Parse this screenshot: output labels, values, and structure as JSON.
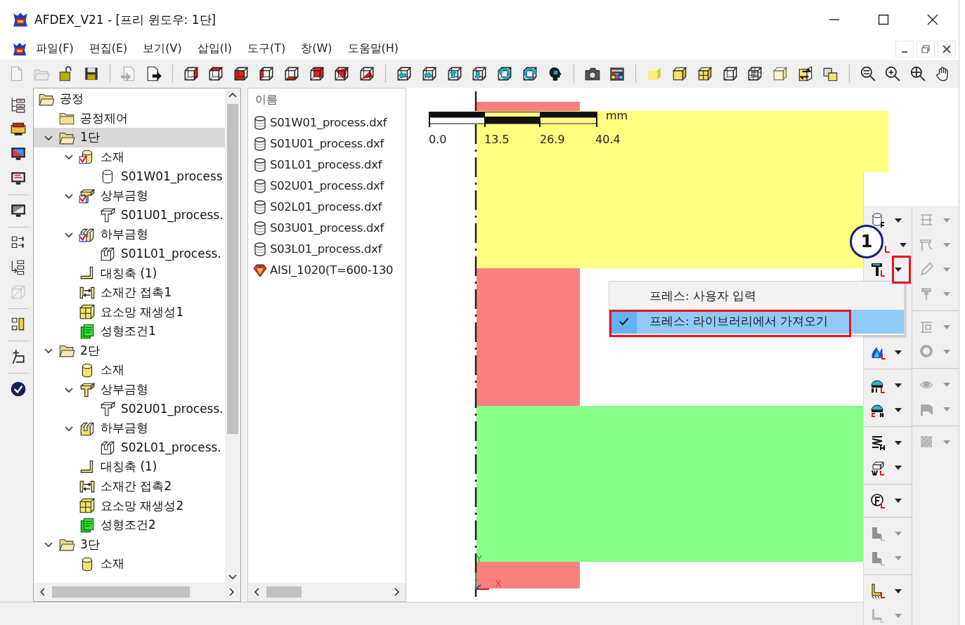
{
  "window": {
    "title": "AFDEX_V21 - [프리 윈도우: 1단]"
  },
  "menu": [
    "파일(F)",
    "편집(E)",
    "보기(V)",
    "삽입(I)",
    "도구(T)",
    "창(W)",
    "도움말(H)"
  ],
  "toolbar": {
    "groups": [
      [
        {
          "disabled": true
        },
        {
          "disabled": true
        },
        {
          "disabled": false
        },
        {
          "disabled": false
        }
      ],
      [
        {
          "disabled": true
        },
        {
          "disabled": false
        }
      ],
      [
        {
          "disabled": false
        },
        {
          "disabled": false
        },
        {
          "disabled": false
        },
        {
          "disabled": false
        },
        {
          "disabled": false
        },
        {
          "disabled": false
        },
        {
          "disabled": false
        },
        {
          "disabled": false
        }
      ],
      [
        {
          "disabled": false
        },
        {
          "disabled": false
        },
        {
          "disabled": false
        },
        {
          "disabled": false
        },
        {
          "disabled": false
        },
        {
          "disabled": false
        },
        {
          "disabled": false
        }
      ],
      [
        {
          "disabled": false
        },
        {
          "disabled": false
        }
      ],
      [
        {
          "disabled": false
        },
        {
          "disabled": false
        },
        {
          "disabled": false
        },
        {
          "disabled": false
        },
        {
          "disabled": false
        },
        {
          "disabled": false
        },
        {
          "disabled": false
        },
        {
          "disabled": false
        }
      ],
      [
        {
          "disabled": false
        },
        {
          "disabled": false
        },
        {
          "disabled": false
        },
        {
          "disabled": false
        }
      ]
    ]
  },
  "tool_strip": {
    "groups": [
      [
        {
          "disabled": false
        },
        {
          "disabled": false
        },
        {
          "disabled": false
        },
        {
          "disabled": false
        }
      ],
      [
        {
          "disabled": false
        }
      ],
      [
        {
          "disabled": false
        },
        {
          "disabled": false
        },
        {
          "disabled": true
        }
      ],
      [
        {
          "disabled": false
        }
      ],
      [
        {
          "disabled": false
        }
      ],
      [
        {
          "disabled": false
        }
      ]
    ]
  },
  "tree": {
    "items": [
      {
        "label": "공정",
        "kind": "folder-open",
        "selected": false,
        "children": [
          {
            "label": "공정제어",
            "kind": "folder",
            "selected": false
          },
          {
            "label": "1단",
            "kind": "folder-open",
            "selected": true,
            "expanded": true,
            "children": [
              {
                "label": "소재",
                "kind": "material",
                "selected": false,
                "expanded": true,
                "checked": true,
                "children": [
                  {
                    "label": "S01W01_process",
                    "kind": "file-material",
                    "selected": false
                  }
                ]
              },
              {
                "label": "상부금형",
                "kind": "upper-die",
                "selected": false,
                "expanded": true,
                "checked": true,
                "children": [
                  {
                    "label": "S01U01_process.",
                    "kind": "file-upper",
                    "selected": false
                  }
                ]
              },
              {
                "label": "하부금형",
                "kind": "lower-die",
                "selected": false,
                "expanded": true,
                "checked": true,
                "children": [
                  {
                    "label": "S01L01_process.",
                    "kind": "file-lower",
                    "selected": false
                  }
                ]
              },
              {
                "label": "대칭축 (1)",
                "kind": "symmetry",
                "selected": false
              },
              {
                "label": "소재간 접촉1",
                "kind": "contact",
                "selected": false
              },
              {
                "label": "요소망 재생성1",
                "kind": "remesh",
                "selected": false
              },
              {
                "label": "성형조건1",
                "kind": "condition",
                "selected": false
              }
            ]
          },
          {
            "label": "2단",
            "kind": "folder-open",
            "selected": false,
            "expanded": true,
            "children": [
              {
                "label": "소재",
                "kind": "material",
                "selected": false,
                "checked": false
              },
              {
                "label": "상부금형",
                "kind": "upper-die",
                "selected": false,
                "expanded": true,
                "checked": false,
                "children": [
                  {
                    "label": "S02U01_process.",
                    "kind": "file-upper",
                    "selected": false
                  }
                ]
              },
              {
                "label": "하부금형",
                "kind": "lower-die",
                "selected": false,
                "expanded": true,
                "checked": false,
                "children": [
                  {
                    "label": "S02L01_process.",
                    "kind": "file-lower",
                    "selected": false
                  }
                ]
              },
              {
                "label": "대칭축 (1)",
                "kind": "symmetry",
                "selected": false
              },
              {
                "label": "소재간 접촉2",
                "kind": "contact",
                "selected": false
              },
              {
                "label": "요소망 재생성2",
                "kind": "remesh",
                "selected": false
              },
              {
                "label": "성형조건2",
                "kind": "condition",
                "selected": false
              }
            ]
          },
          {
            "label": "3단",
            "kind": "folder-open",
            "selected": false,
            "expanded": true,
            "children": [
              {
                "label": "소재",
                "kind": "material",
                "selected": false,
                "checked": false
              }
            ]
          }
        ]
      }
    ]
  },
  "file_list": {
    "header": "이름",
    "items": [
      {
        "label": "S01W01_process.dxf",
        "kind": "shape-file"
      },
      {
        "label": "S01U01_process.dxf",
        "kind": "shape-file"
      },
      {
        "label": "S01L01_process.dxf",
        "kind": "shape-file"
      },
      {
        "label": "S02U01_process.dxf",
        "kind": "shape-file"
      },
      {
        "label": "S02L01_process.dxf",
        "kind": "shape-file"
      },
      {
        "label": "S03U01_process.dxf",
        "kind": "shape-file"
      },
      {
        "label": "S03L01_process.dxf",
        "kind": "shape-file"
      },
      {
        "label": "AISI_1020(T=600-130",
        "kind": "material-data"
      }
    ]
  },
  "canvas": {
    "scale": {
      "unit": "mm",
      "labels": [
        "0.0",
        "13.5",
        "26.9",
        "40.4"
      ]
    },
    "axes": {
      "y": "Y",
      "x": "X"
    }
  },
  "side_toolbar": {
    "columns": [
      [
        [
          {
            "disabled": false
          },
          {
            "disabled": false
          },
          {
            "disabled": false
          },
          {
            "disabled": false
          }
        ],
        [
          {
            "disabled": false
          },
          {
            "disabled": false
          }
        ],
        [
          {
            "disabled": false
          },
          {
            "disabled": false
          }
        ],
        [
          {
            "disabled": false
          }
        ],
        [
          {
            "disabled": true
          },
          {
            "disabled": true
          }
        ],
        [
          {
            "disabled": false
          },
          {
            "disabled": true
          }
        ]
      ],
      [
        [
          {
            "disabled": true
          },
          {
            "disabled": true
          },
          {
            "disabled": true
          },
          {
            "disabled": true
          }
        ],
        [
          {
            "disabled": true
          },
          {
            "disabled": true
          }
        ],
        [
          {
            "disabled": true
          },
          {
            "disabled": true
          }
        ],
        [
          {
            "disabled": true
          }
        ]
      ]
    ]
  },
  "context_menu": {
    "items": [
      {
        "label": "프레스: 사용자 입력",
        "checked": false,
        "selected": false
      },
      {
        "label": "프레스: 라이브러리에서 가져오기",
        "checked": true,
        "selected": true
      }
    ]
  },
  "callout": "1"
}
